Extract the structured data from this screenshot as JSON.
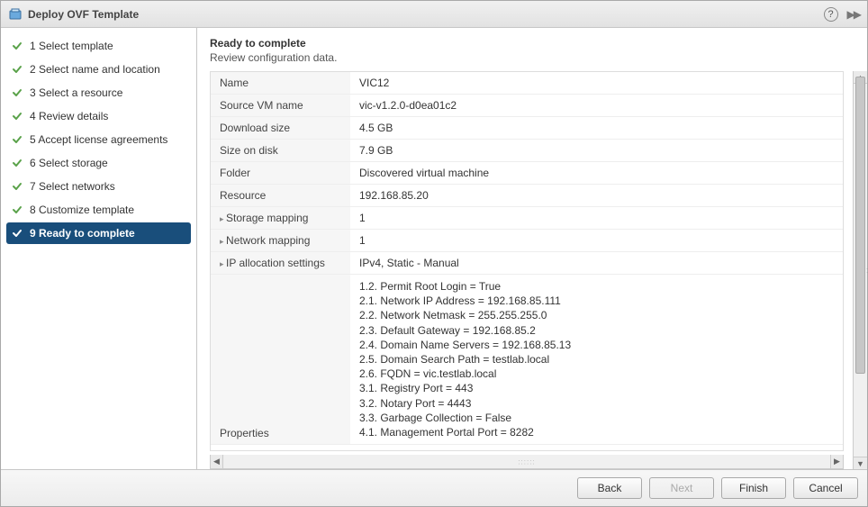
{
  "dialog": {
    "title": "Deploy OVF Template",
    "help_glyph": "?"
  },
  "steps": [
    {
      "n": "1",
      "label": "Select template",
      "active": false
    },
    {
      "n": "2",
      "label": "Select name and location",
      "active": false
    },
    {
      "n": "3",
      "label": "Select a resource",
      "active": false
    },
    {
      "n": "4",
      "label": "Review details",
      "active": false
    },
    {
      "n": "5",
      "label": "Accept license agreements",
      "active": false
    },
    {
      "n": "6",
      "label": "Select storage",
      "active": false
    },
    {
      "n": "7",
      "label": "Select networks",
      "active": false
    },
    {
      "n": "8",
      "label": "Customize template",
      "active": false
    },
    {
      "n": "9",
      "label": "Ready to complete",
      "active": true
    }
  ],
  "main": {
    "heading": "Ready to complete",
    "sub": "Review configuration data."
  },
  "summary": {
    "rows": [
      {
        "key": "Name",
        "val": "VIC12",
        "expand": false
      },
      {
        "key": "Source VM name",
        "val": "vic-v1.2.0-d0ea01c2",
        "expand": false
      },
      {
        "key": "Download size",
        "val": "4.5 GB",
        "expand": false
      },
      {
        "key": "Size on disk",
        "val": "7.9 GB",
        "expand": false
      },
      {
        "key": "Folder",
        "val": "Discovered virtual machine",
        "expand": false
      },
      {
        "key": "Resource",
        "val": "192.168.85.20",
        "expand": false
      },
      {
        "key": "Storage mapping",
        "val": "1",
        "expand": true
      },
      {
        "key": "Network mapping",
        "val": "1",
        "expand": true
      },
      {
        "key": "IP allocation settings",
        "val": "IPv4, Static - Manual",
        "expand": true
      }
    ],
    "properties_key": "Properties",
    "properties": [
      "1.2. Permit Root Login = True",
      "2.1. Network IP Address = 192.168.85.111",
      "2.2. Network Netmask = 255.255.255.0",
      "2.3. Default Gateway = 192.168.85.2",
      "2.4. Domain Name Servers = 192.168.85.13",
      "2.5. Domain Search Path = testlab.local",
      "2.6. FQDN = vic.testlab.local",
      "3.1. Registry Port = 443",
      "3.2. Notary Port = 4443",
      "3.3. Garbage Collection = False",
      "4.1. Management Portal Port = 8282"
    ]
  },
  "buttons": {
    "back": "Back",
    "next": "Next",
    "finish": "Finish",
    "cancel": "Cancel"
  }
}
